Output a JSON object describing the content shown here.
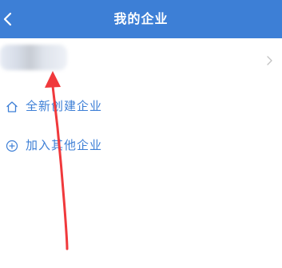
{
  "header": {
    "title": "我的企业",
    "back_icon": "chevron-left-icon"
  },
  "company_list": {
    "items": [
      {
        "name_obscured": true,
        "chevron_icon": "chevron-right-icon"
      }
    ]
  },
  "actions": {
    "create": {
      "label": "全新创建企业",
      "icon": "home-icon"
    },
    "join": {
      "label": "加入其他企业",
      "icon": "plus-circle-icon"
    }
  },
  "colors": {
    "header_bg": "#3d7fd6",
    "accent": "#3d7fd6",
    "annotation": "#f0393c"
  }
}
